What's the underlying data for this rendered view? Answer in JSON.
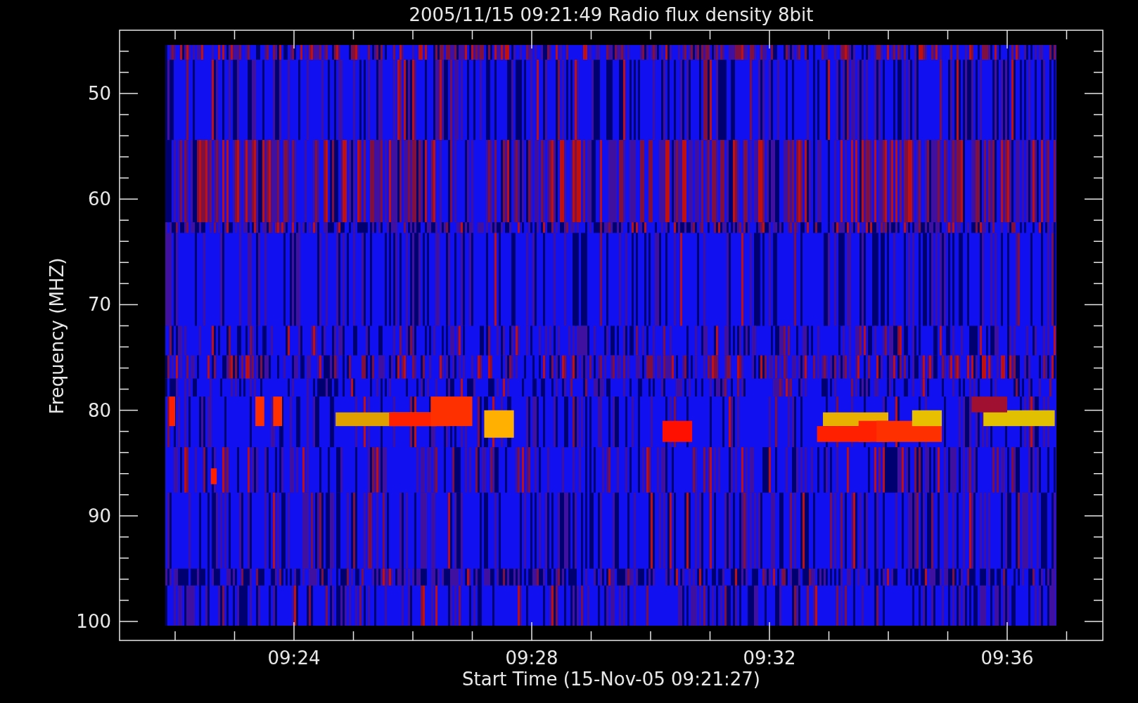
{
  "title": "2005/11/15 09:21:49 Radio flux density 8bit",
  "y_axis": {
    "label": "Frequency (MHZ)",
    "ticks": [
      "50",
      "60",
      "70",
      "80",
      "90",
      "100"
    ]
  },
  "x_axis": {
    "label": "Start Time (15-Nov-05 09:21:27)",
    "ticks": [
      "09:24",
      "09:28",
      "09:32",
      "09:36"
    ]
  }
}
